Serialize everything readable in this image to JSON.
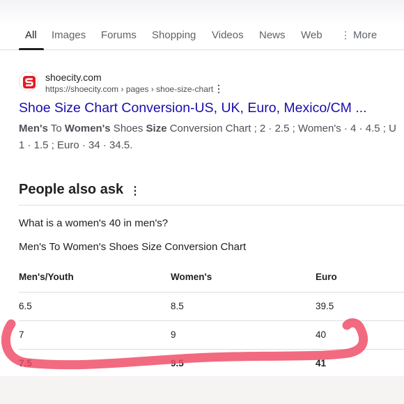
{
  "tabs": [
    {
      "label": "All",
      "active": true
    },
    {
      "label": "Images",
      "active": false
    },
    {
      "label": "Forums",
      "active": false
    },
    {
      "label": "Shopping",
      "active": false
    },
    {
      "label": "Videos",
      "active": false
    },
    {
      "label": "News",
      "active": false
    },
    {
      "label": "Web",
      "active": false
    },
    {
      "label": "More",
      "active": false
    }
  ],
  "result": {
    "site_name": "shoecity.com",
    "url": "https://shoecity.com › pages › shoe-size-chart",
    "title": "Shoe Size Chart Conversion-US, UK, Euro, Mexico/CM ...",
    "snippet_line1": [
      {
        "text": "Men's",
        "bold": true
      },
      {
        "text": " To ",
        "bold": false
      },
      {
        "text": "Women's",
        "bold": true
      },
      {
        "text": " Shoes ",
        "bold": false
      },
      {
        "text": "Size",
        "bold": true
      },
      {
        "text": " Conversion Chart ; 2 · 2.5 ; Women's · 4 · 4.5 ; U",
        "bold": false
      }
    ],
    "snippet_line2": "1 · 1.5 ; Euro · 34 · 34.5."
  },
  "paa": {
    "heading": "People also ask",
    "question": "What is a women's 40 in men's?",
    "answer_title": "Men's To Women's Shoes Size Conversion Chart",
    "table": {
      "headers": [
        "Men's/Youth",
        "Women's",
        "Euro"
      ],
      "rows": [
        {
          "cells": [
            "6.5",
            "8.5",
            "39.5"
          ],
          "bold": false
        },
        {
          "cells": [
            "7",
            "9",
            "40"
          ],
          "bold": false
        },
        {
          "cells": [
            "7.5",
            "9.5",
            "41"
          ],
          "bold": true
        }
      ]
    }
  },
  "colors": {
    "link": "#1a0dab",
    "marker": "#f0506a",
    "favicon_red": "#e31b23"
  },
  "icons": {
    "favicon": "shoecity-logo-icon",
    "more": "vertical-dots-icon"
  }
}
